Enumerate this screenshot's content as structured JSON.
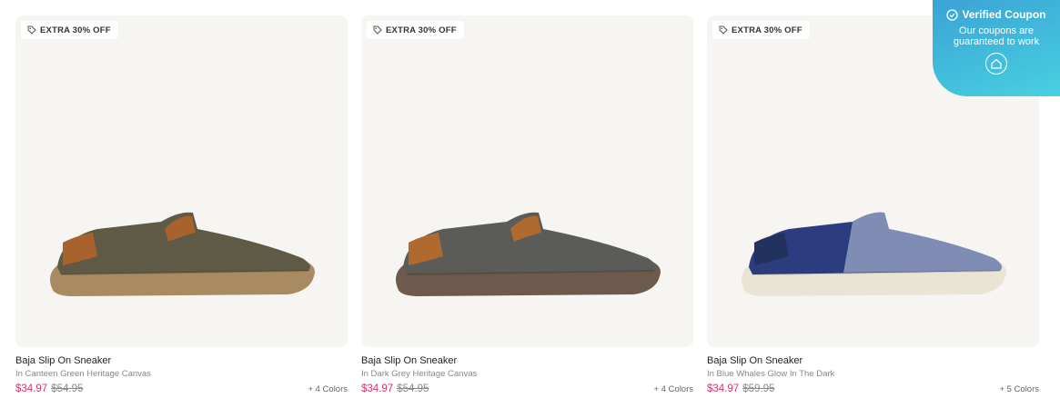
{
  "products": [
    {
      "badge": "EXTRA 30% OFF",
      "title": "Baja Slip On Sneaker",
      "subtitle": "In Canteen Green Heritage Canvas",
      "sale_price": "$34.97",
      "original_price": "$54.95",
      "colors": "+ 4 Colors",
      "shoe_colors": {
        "upper": "#5f5a45",
        "sole": "#a88b60",
        "trim": "#a8622e"
      }
    },
    {
      "badge": "EXTRA 30% OFF",
      "title": "Baja Slip On Sneaker",
      "subtitle": "In Dark Grey Heritage Canvas",
      "sale_price": "$34.97",
      "original_price": "$54.95",
      "colors": "+ 4 Colors",
      "shoe_colors": {
        "upper": "#5b5b58",
        "sole": "#6e5a4c",
        "trim": "#b06a2e"
      }
    },
    {
      "badge": "EXTRA 30% OFF",
      "title": "Baja Slip On Sneaker",
      "subtitle": "In Blue Whales Glow In The Dark",
      "sale_price": "$34.97",
      "original_price": "$59.95",
      "colors": "+ 5 Colors",
      "shoe_colors": {
        "upper": "#2b3d7e",
        "sole": "#e9e4d4",
        "trim": "#22325f"
      }
    }
  ],
  "verified_coupon": {
    "title": "Verified Coupon",
    "text": "Our coupons are guaranteed to work"
  },
  "colors": {
    "sale_price": "#d6336c",
    "card_background": "#f6f5f2",
    "verified_gradient_start": "#3ba3d6",
    "verified_gradient_end": "#48d0e0"
  }
}
